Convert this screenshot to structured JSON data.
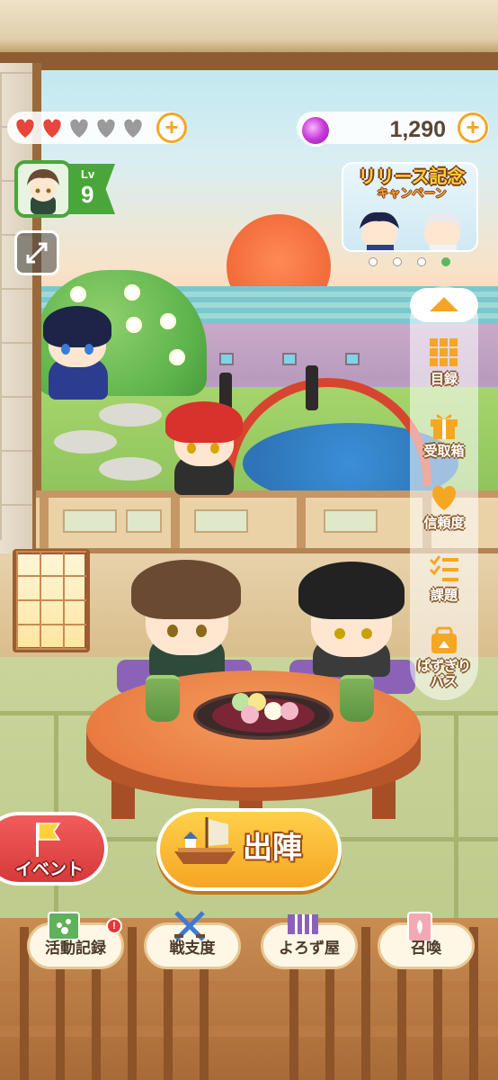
{
  "status": {
    "hearts": {
      "filled": 2,
      "total": 5
    },
    "currency": {
      "value": "1,290",
      "icon": "gem-icon"
    },
    "plus_label": "+"
  },
  "player": {
    "level_label": "Lv",
    "level_value": "9"
  },
  "banner": {
    "title": "リリース記念",
    "subtitle": "キャンペーン",
    "page_count": 4,
    "active_page": 4
  },
  "side_menu": {
    "items": [
      {
        "label": "目録",
        "icon": "catalog-icon"
      },
      {
        "label": "受取箱",
        "icon": "gift-box-icon"
      },
      {
        "label": "信頼度",
        "icon": "heart-icon"
      },
      {
        "label": "課題",
        "icon": "checklist-icon"
      },
      {
        "label": "ぱずぎり\nパス",
        "icon": "pass-bag-icon"
      }
    ]
  },
  "actions": {
    "event_label": "イベント",
    "sortie_label": "出陣"
  },
  "bottom_nav": {
    "items": [
      {
        "label": "活動記録",
        "icon": "activity-log-icon",
        "badge": "!"
      },
      {
        "label": "戦支度",
        "icon": "crossed-swords-icon"
      },
      {
        "label": "よろず屋",
        "icon": "shop-icon"
      },
      {
        "label": "召喚",
        "icon": "summon-card-icon"
      }
    ]
  },
  "colors": {
    "accent": "#f5a623",
    "level_green": "#4aa63a",
    "event_red": "#e04848",
    "heart_red": "#e8453c",
    "heart_empty": "#9a9a9a"
  }
}
